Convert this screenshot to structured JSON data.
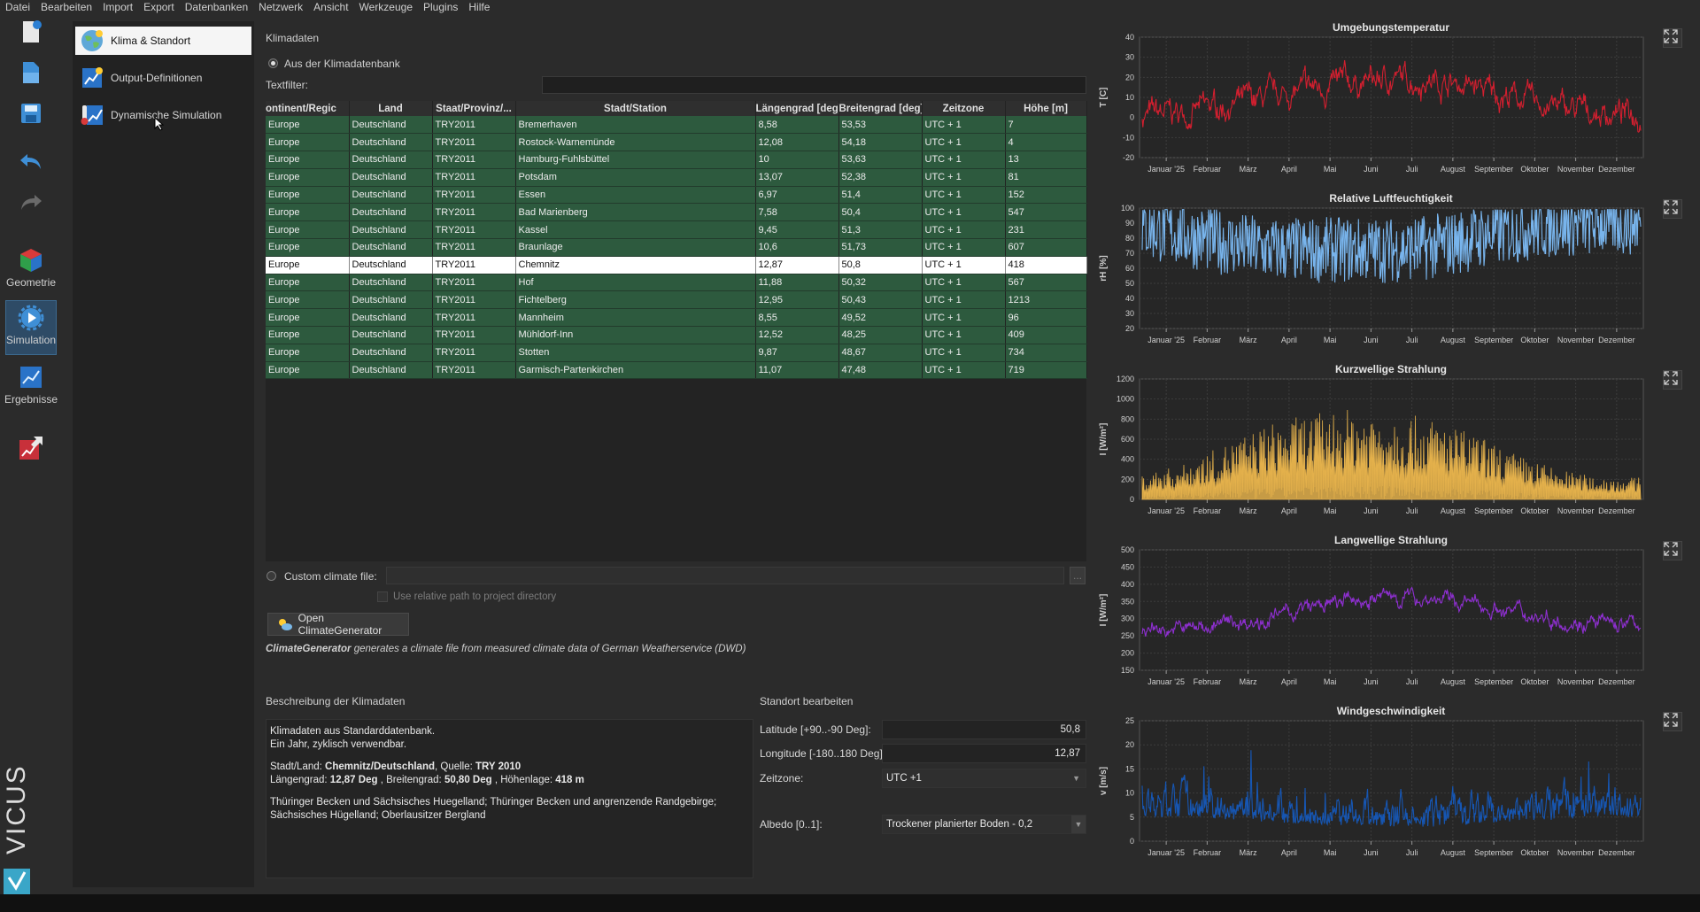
{
  "menu": [
    "Datei",
    "Bearbeiten",
    "Import",
    "Export",
    "Datenbanken",
    "Netzwerk",
    "Ansicht",
    "Werkzeuge",
    "Plugins",
    "Hilfe"
  ],
  "toolbar": {
    "geometry_label": "Geometrie",
    "simulation_label": "Simulation",
    "results_label": "Ergebnisse"
  },
  "nav": [
    {
      "label": "Klima & Standort",
      "icon": "globe-icon"
    },
    {
      "label": "Output-Definitionen",
      "icon": "chart-icon"
    },
    {
      "label": "Dynamische Simulation",
      "icon": "thermometer-icon"
    }
  ],
  "climate": {
    "title": "Klimadaten",
    "radio_db": "Aus der Klimadatenbank",
    "filter_label": "Textfilter:",
    "filter_value": "",
    "columns": [
      "ontinent/Regic",
      "Land",
      "Staat/Provinz/...",
      "Stadt/Station",
      "Längengrad [deg]",
      "Breitengrad [deg]",
      "Zeitzone",
      "Höhe [m]"
    ],
    "selected_index": 8,
    "rows": [
      [
        "Europe",
        "Deutschland",
        "TRY2011",
        "Bremerhaven",
        "8,58",
        "53,53",
        "UTC + 1",
        "7"
      ],
      [
        "Europe",
        "Deutschland",
        "TRY2011",
        "Rostock-Warnemünde",
        "12,08",
        "54,18",
        "UTC + 1",
        "4"
      ],
      [
        "Europe",
        "Deutschland",
        "TRY2011",
        "Hamburg-Fuhlsbüttel",
        "10",
        "53,63",
        "UTC + 1",
        "13"
      ],
      [
        "Europe",
        "Deutschland",
        "TRY2011",
        "Potsdam",
        "13,07",
        "52,38",
        "UTC + 1",
        "81"
      ],
      [
        "Europe",
        "Deutschland",
        "TRY2011",
        "Essen",
        "6,97",
        "51,4",
        "UTC + 1",
        "152"
      ],
      [
        "Europe",
        "Deutschland",
        "TRY2011",
        "Bad Marienberg",
        "7,58",
        "50,4",
        "UTC + 1",
        "547"
      ],
      [
        "Europe",
        "Deutschland",
        "TRY2011",
        "Kassel",
        "9,45",
        "51,3",
        "UTC + 1",
        "231"
      ],
      [
        "Europe",
        "Deutschland",
        "TRY2011",
        "Braunlage",
        "10,6",
        "51,73",
        "UTC + 1",
        "607"
      ],
      [
        "Europe",
        "Deutschland",
        "TRY2011",
        "Chemnitz",
        "12,87",
        "50,8",
        "UTC + 1",
        "418"
      ],
      [
        "Europe",
        "Deutschland",
        "TRY2011",
        "Hof",
        "11,88",
        "50,32",
        "UTC + 1",
        "567"
      ],
      [
        "Europe",
        "Deutschland",
        "TRY2011",
        "Fichtelberg",
        "12,95",
        "50,43",
        "UTC + 1",
        "1213"
      ],
      [
        "Europe",
        "Deutschland",
        "TRY2011",
        "Mannheim",
        "8,55",
        "49,52",
        "UTC + 1",
        "96"
      ],
      [
        "Europe",
        "Deutschland",
        "TRY2011",
        "Mühldorf-Inn",
        "12,52",
        "48,25",
        "UTC + 1",
        "409"
      ],
      [
        "Europe",
        "Deutschland",
        "TRY2011",
        "Stotten",
        "9,87",
        "48,67",
        "UTC + 1",
        "734"
      ],
      [
        "Europe",
        "Deutschland",
        "TRY2011",
        "Garmisch-Partenkirchen",
        "11,07",
        "47,48",
        "UTC + 1",
        "719"
      ]
    ],
    "custom_label": "Custom climate file:",
    "custom_value": "",
    "browse_label": "...",
    "relative_label": "Use relative path to project directory",
    "open_generator_label": "Open ClimateGenerator",
    "generator_name": "ClimateGenerator",
    "generator_text": " generates a climate file from measured climate data of German Weatherservice (DWD)"
  },
  "description": {
    "title": "Beschreibung der Klimadaten",
    "line1": "Klimadaten aus Standarddatenbank.",
    "line2": "Ein Jahr, zyklisch verwendbar.",
    "city_prefix": "Stadt/Land: ",
    "city": "Chemnitz/Deutschland",
    "source_prefix": ", Quelle: ",
    "source": "TRY 2010",
    "lon_prefix": "Längengrad: ",
    "lon": "12,87 Deg",
    "lat_prefix": " , Breitengrad: ",
    "lat": "50,80 Deg",
    "alt_prefix": " , Höhenlage: ",
    "alt": "418 m",
    "region": "Thüringer Becken und Sächsisches Huegelland; Thüringer Becken und angrenzende Randgebirge; Sächsisches Hügelland; Oberlausitzer Bergland"
  },
  "location": {
    "title": "Standort bearbeiten",
    "lat_label": "Latitude [+90..-90 Deg]:",
    "lat_value": "50,8",
    "lon_label": "Longitude [-180..180 Deg]:",
    "lon_value": "12,87",
    "tz_label": "Zeitzone:",
    "tz_value": "UTC +1",
    "albedo_label": "Albedo [0..1]:",
    "albedo_value": "Trockener planierter Boden - 0,2"
  },
  "chart_data": [
    {
      "type": "line",
      "title": "Umgebungstemperatur",
      "ylabel": "T [C]",
      "ylim": [
        -20,
        40
      ],
      "yticks": [
        40,
        30,
        20,
        10,
        0,
        -10,
        -20
      ],
      "color": "#d21f2f",
      "base": [
        1,
        2,
        6,
        9,
        14,
        17,
        19,
        19,
        15,
        10,
        5,
        2
      ],
      "amp": 9,
      "clip": [
        -15,
        34
      ],
      "categories": [
        "Januar '25",
        "Februar",
        "März",
        "April",
        "Mai",
        "Juni",
        "Juli",
        "August",
        "September",
        "Oktober",
        "November",
        "Dezember"
      ],
      "grid": true,
      "style": "noise"
    },
    {
      "type": "line",
      "title": "Relative Luftfeuchtigkeit",
      "ylabel": "rH [%]",
      "ylim": [
        20,
        100
      ],
      "yticks": [
        100,
        90,
        80,
        70,
        60,
        50,
        40,
        30,
        20
      ],
      "color": "#78b4ec",
      "base": [
        85,
        80,
        75,
        70,
        70,
        70,
        70,
        72,
        78,
        83,
        87,
        88
      ],
      "amp": 22,
      "clip": [
        25,
        99
      ],
      "categories": [
        "Januar '25",
        "Februar",
        "März",
        "April",
        "Mai",
        "Juni",
        "Juli",
        "August",
        "September",
        "Oktober",
        "November",
        "Dezember"
      ],
      "grid": true,
      "style": "fast"
    },
    {
      "type": "area",
      "title": "Kurzwellige Strahlung",
      "ylabel": "I [W/m²]",
      "ylim": [
        0,
        1200
      ],
      "yticks": [
        1200,
        1000,
        800,
        600,
        400,
        200,
        0
      ],
      "color": "#e3b04b",
      "base": [
        250,
        350,
        550,
        750,
        850,
        900,
        880,
        800,
        650,
        450,
        300,
        220
      ],
      "amp": 0,
      "clip": [
        0,
        1150
      ],
      "categories": [
        "Januar '25",
        "Februar",
        "März",
        "April",
        "Mai",
        "Juni",
        "Juli",
        "August",
        "September",
        "Oktober",
        "November",
        "Dezember"
      ],
      "grid": true,
      "style": "solar"
    },
    {
      "type": "line",
      "title": "Langwellige Strahlung",
      "ylabel": "I [W/m²]",
      "ylim": [
        150,
        500
      ],
      "yticks": [
        500,
        450,
        400,
        350,
        300,
        250,
        200,
        150
      ],
      "color": "#8e2fd0",
      "base": [
        275,
        270,
        285,
        300,
        330,
        350,
        365,
        360,
        340,
        320,
        300,
        285
      ],
      "amp": 32,
      "clip": [
        160,
        460
      ],
      "categories": [
        "Januar '25",
        "Februar",
        "März",
        "April",
        "Mai",
        "Juni",
        "Juli",
        "August",
        "September",
        "Oktober",
        "November",
        "Dezember"
      ],
      "grid": true,
      "style": "noise"
    },
    {
      "type": "line",
      "title": "Windgeschwindigkeit",
      "ylabel": "v [m/s]",
      "ylim": [
        0,
        25
      ],
      "yticks": [
        25,
        20,
        15,
        10,
        5,
        0
      ],
      "color": "#1656b3",
      "base": [
        5,
        5,
        4.5,
        4,
        3.5,
        3.2,
        3,
        3,
        3.5,
        4,
        4.5,
        5
      ],
      "amp": 4,
      "clip": [
        0,
        22
      ],
      "categories": [
        "Januar '25",
        "Februar",
        "März",
        "April",
        "Mai",
        "Juni",
        "Juli",
        "August",
        "September",
        "Oktober",
        "November",
        "Dezember"
      ],
      "grid": true,
      "style": "wind"
    }
  ],
  "brand": "VICUS"
}
